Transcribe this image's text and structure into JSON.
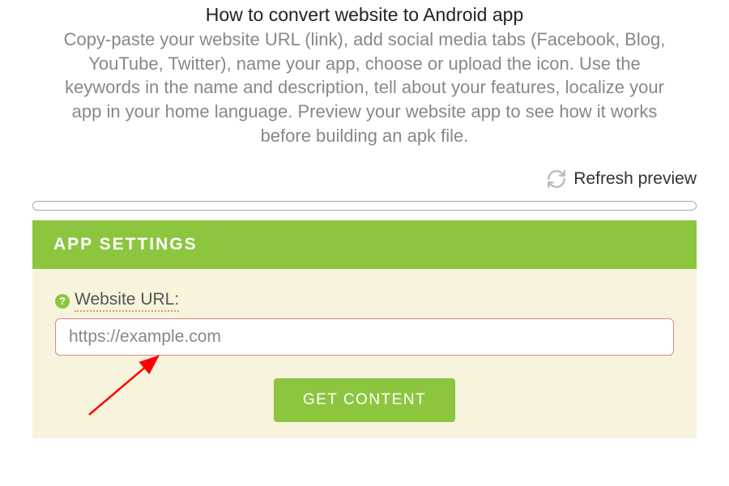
{
  "header": {
    "title": "How to convert website to Android app",
    "description": "Copy-paste your website URL (link), add social media tabs (Facebook, Blog, YouTube, Twitter), name your app, choose or upload the icon. Use the keywords in the name and description, tell about your features, localize your app in your home language. Preview your website app to see how it works before building an apk file."
  },
  "refresh": {
    "label": "Refresh preview"
  },
  "settings": {
    "panel_title": "APP SETTINGS",
    "help_symbol": "?",
    "url_label": "Website URL:",
    "url_value": "https://example.com",
    "get_content_label": "GET CONTENT"
  }
}
